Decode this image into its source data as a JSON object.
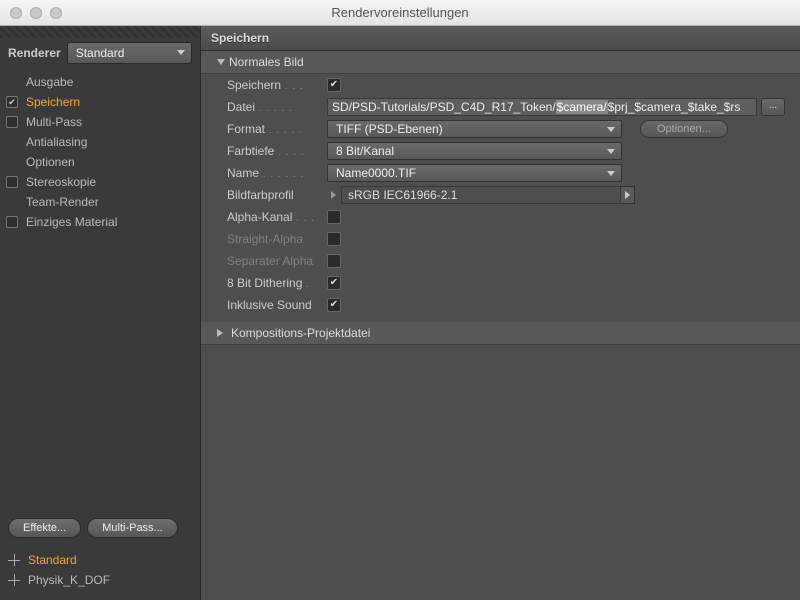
{
  "window": {
    "title": "Rendervoreinstellungen"
  },
  "sidebar": {
    "renderer_label": "Renderer",
    "renderer_value": "Standard",
    "items": [
      {
        "label": "Ausgabe",
        "checkbox": null
      },
      {
        "label": "Speichern",
        "checkbox": true,
        "active": true
      },
      {
        "label": "Multi-Pass",
        "checkbox": false
      },
      {
        "label": "Antialiasing",
        "checkbox": null
      },
      {
        "label": "Optionen",
        "checkbox": null
      },
      {
        "label": "Stereoskopie",
        "checkbox": false
      },
      {
        "label": "Team-Render",
        "checkbox": null
      },
      {
        "label": "Einziges Material",
        "checkbox": false
      }
    ],
    "buttons": {
      "effects": "Effekte...",
      "multipass": "Multi-Pass..."
    },
    "presets": [
      {
        "label": "Standard",
        "active": true
      },
      {
        "label": "Physik_K_DOF",
        "active": false
      }
    ]
  },
  "panel": {
    "title": "Speichern",
    "group_normal": "Normales Bild",
    "group_comp": "Kompositions-Projektdatei",
    "labels": {
      "save": "Speichern",
      "file": "Datei",
      "format": "Format",
      "depth": "Farbtiefe",
      "name": "Name",
      "profile": "Bildfarbprofil",
      "alpha": "Alpha-Kanal",
      "straight": "Straight-Alpha",
      "sepalpha": "Separater Alpha",
      "dither": "8 Bit Dithering",
      "sound": "Inklusive Sound"
    },
    "values": {
      "save": true,
      "file_prefix": "SD/PSD-Tutorials/PSD_C4D_R17_Token/",
      "file_hl": "$camera/",
      "file_suffix": "$prj_$camera_$take_$rs",
      "format": "TIFF (PSD-Ebenen)",
      "depth": "8 Bit/Kanal",
      "name": "Name0000.TIF",
      "profile": "sRGB IEC61966-2.1",
      "alpha": false,
      "straight": false,
      "sepalpha": false,
      "dither": true,
      "sound": true
    },
    "options_btn": "Optionen...",
    "more_btn": "..."
  }
}
